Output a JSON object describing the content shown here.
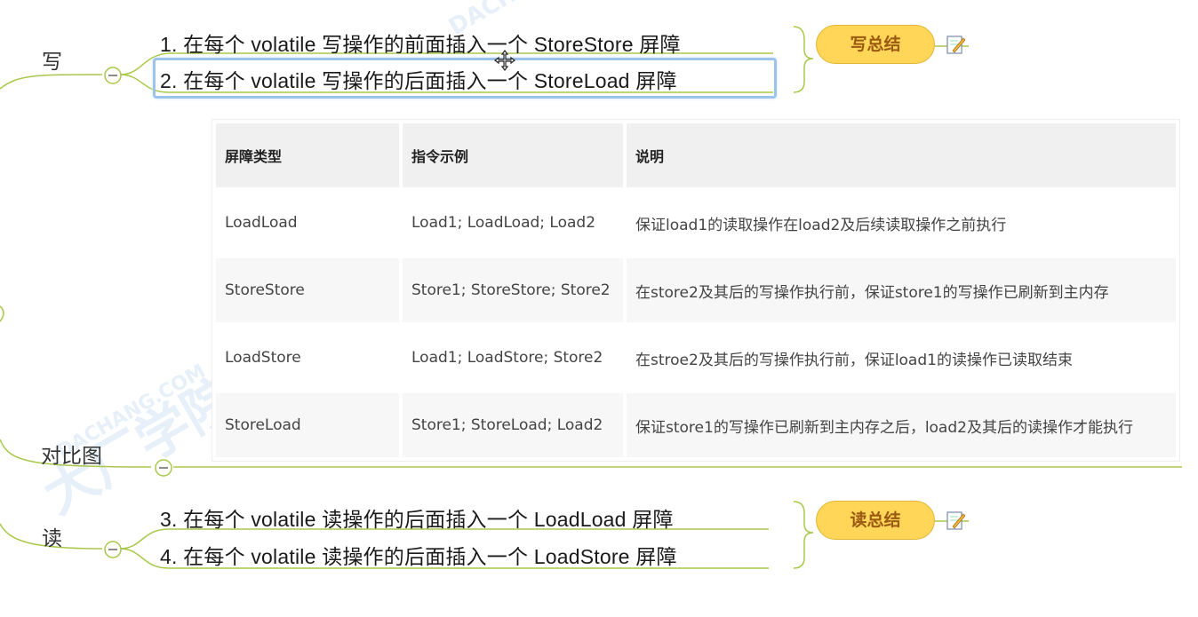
{
  "write_branch": {
    "label": "写",
    "items": [
      "1. 在每个 volatile 写操作的前面插入一个 StoreStore 屏障",
      "2. 在每个 volatile 写操作的后面插入一个 StoreLoad 屏障"
    ],
    "summary": "写总结"
  },
  "compare_branch": {
    "label": "对比图"
  },
  "read_branch": {
    "label": "读",
    "items": [
      "3. 在每个 volatile 读操作的后面插入一个 LoadLoad 屏障",
      "4. 在每个 volatile 读操作的后面插入一个 LoadStore 屏障"
    ],
    "summary": "读总结"
  },
  "table": {
    "headers": [
      "屏障类型",
      "指令示例",
      "说明"
    ],
    "rows": [
      [
        "LoadLoad",
        "Load1; LoadLoad; Load2",
        "保证load1的读取操作在load2及后续读取操作之前执行"
      ],
      [
        "StoreStore",
        "Store1; StoreStore; Store2",
        "在store2及其后的写操作执行前，保证store1的写操作已刷新到主内存"
      ],
      [
        "LoadStore",
        "Load1; LoadStore; Store2",
        "在stroe2及其后的写操作执行前，保证load1的读操作已读取结束"
      ],
      [
        "StoreLoad",
        "Store1; StoreLoad; Load2",
        "保证store1的写操作已刷新到主内存之后，load2及其后的读操作才能执行"
      ]
    ]
  },
  "watermark": {
    "main": "大厂学院",
    "sub": "DACHANG.COM"
  },
  "colors": {
    "branch_line": "#a8c84a",
    "selection": "#9cc3ec",
    "summary_fill": "#ffd658"
  }
}
